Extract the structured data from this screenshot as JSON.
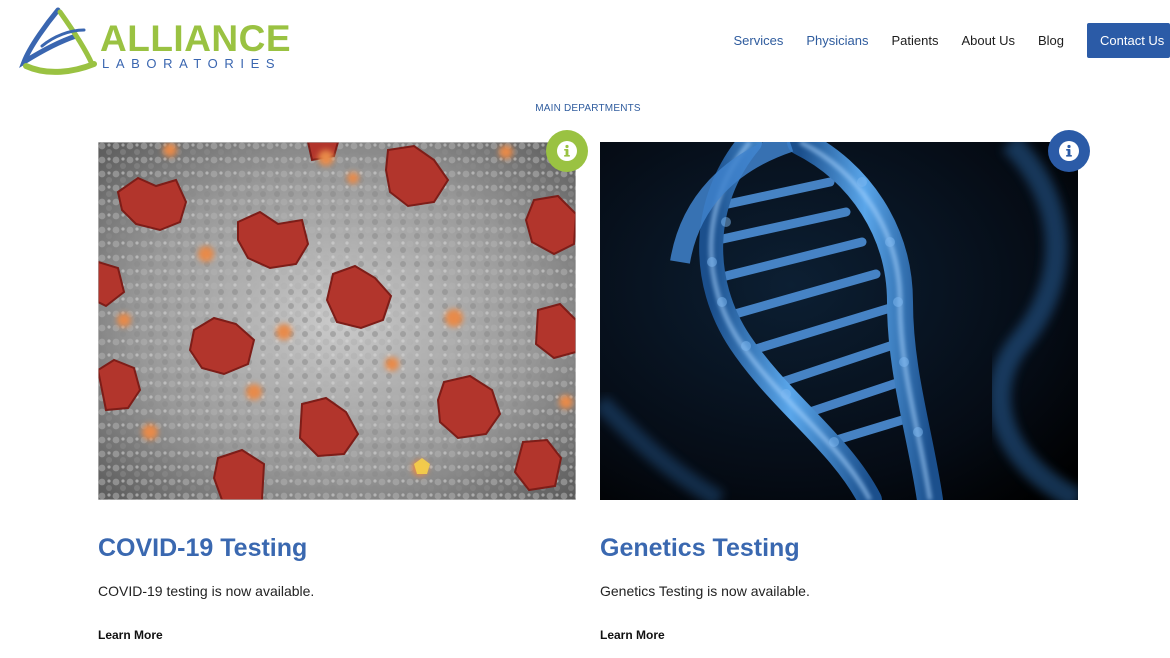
{
  "brand": {
    "name": "ALLIANCE",
    "subtitle": "LABORATORIES",
    "green": "#9ac242",
    "blue": "#2b5ba7"
  },
  "nav": {
    "items": [
      {
        "label": "Services"
      },
      {
        "label": "Physicians"
      },
      {
        "label": "Patients"
      },
      {
        "label": "About Us"
      },
      {
        "label": "Blog"
      }
    ],
    "contact_label": "Contact Us"
  },
  "section": {
    "label": "MAIN DEPARTMENTS"
  },
  "cards": [
    {
      "title": "COVID-19 Testing",
      "text": "COVID-19 testing is now available.",
      "link": "Learn More",
      "badge_icon": "info-icon",
      "badge_color": "#9ac242"
    },
    {
      "title": "Genetics Testing",
      "text": "Genetics Testing is now available.",
      "link": "Learn More",
      "badge_icon": "info-icon",
      "badge_color": "#2b5ba7"
    }
  ]
}
